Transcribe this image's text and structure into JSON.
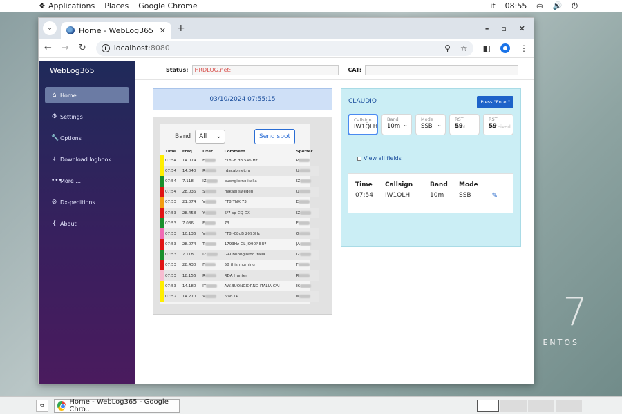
{
  "topbar": {
    "applications": "Applications",
    "places": "Places",
    "app_name": "Google Chrome",
    "lang": "it",
    "time": "08:55"
  },
  "desktop": {
    "logo_numeral": "7",
    "logo_text": "ENTOS"
  },
  "browser": {
    "tab_title": "Home - WebLog365",
    "url_host": "localhost",
    "url_port": ":8080"
  },
  "app": {
    "brand": "WebLog365",
    "nav": [
      {
        "label": "Home",
        "icon": "home-icon",
        "active": true
      },
      {
        "label": "Settings",
        "icon": "gear-icon",
        "active": false
      },
      {
        "label": "Options",
        "icon": "wrench-icon",
        "active": false
      },
      {
        "label": "Download logbook",
        "icon": "download-icon",
        "active": false
      },
      {
        "label": "More ...",
        "icon": "more-icon",
        "active": false
      },
      {
        "label": "Dx-peditions",
        "icon": "compass-icon",
        "active": false
      },
      {
        "label": "About",
        "icon": "braces-icon",
        "active": false
      }
    ],
    "status_label": "Status:",
    "status_value": "HRDLOG.net:",
    "cat_label": "CAT:",
    "datetime": "03/10/2024 07:55:15"
  },
  "spots": {
    "band_label": "Band",
    "band_value": "All",
    "send_spot": "Send spot",
    "columns": [
      "Time",
      "Freq",
      "Dxer",
      "Comment",
      "Spotter"
    ],
    "rows": [
      {
        "color": "#ffee00",
        "time": "07:54",
        "freq": "14.074",
        "dxer": "F",
        "comment": "FT8 -8 dB 546 Hz",
        "spotter": "P"
      },
      {
        "color": "#ffee00",
        "time": "07:54",
        "freq": "14.040",
        "dxer": "R",
        "comment": "rdacabinet.ru",
        "spotter": "U"
      },
      {
        "color": "#1a8f2c",
        "time": "07:54",
        "freq": "7.118",
        "dxer": "IZ",
        "comment": "buongiorno italia",
        "spotter": "IZ"
      },
      {
        "color": "#e01414",
        "time": "07:54",
        "freq": "28.036",
        "dxer": "S",
        "comment": "mikael sweden",
        "spotter": "U"
      },
      {
        "color": "#f39c12",
        "time": "07:53",
        "freq": "21.074",
        "dxer": "V",
        "comment": "FT8 TNX 73",
        "spotter": "E"
      },
      {
        "color": "#e01414",
        "time": "07:53",
        "freq": "28.458",
        "dxer": "Y",
        "comment": "5/7 sp CQ DX",
        "spotter": "IZ"
      },
      {
        "color": "#1a8f2c",
        "time": "07:53",
        "freq": "7.086",
        "dxer": "F",
        "comment": "73",
        "spotter": "F"
      },
      {
        "color": "#f06ab4",
        "time": "07:53",
        "freq": "10.136",
        "dxer": "V",
        "comment": "FT8 -08dB 2093Hz",
        "spotter": "G"
      },
      {
        "color": "#e01414",
        "time": "07:53",
        "freq": "28.074",
        "dxer": "T",
        "comment": "1793Hz GL JO90? EU?",
        "spotter": "JA"
      },
      {
        "color": "#1a8f2c",
        "time": "07:53",
        "freq": "7.118",
        "dxer": "IZ",
        "comment": "GAI Buongiorno italia",
        "spotter": "IZ"
      },
      {
        "color": "#e01414",
        "time": "07:53",
        "freq": "28.430",
        "dxer": "F",
        "comment": "58 this morning",
        "spotter": "F"
      },
      {
        "color": "#f7bcd0",
        "time": "07:53",
        "freq": "18.156",
        "dxer": "R",
        "comment": "RDA Hunter",
        "spotter": "R"
      },
      {
        "color": "#ffee00",
        "time": "07:53",
        "freq": "14.180",
        "dxer": "IT",
        "comment": "AW.BUONGIORNO ITALIA GAI",
        "spotter": "IK"
      },
      {
        "color": "#ffee00",
        "time": "07:52",
        "freq": "14.270",
        "dxer": "V",
        "comment": "Ivan LP",
        "spotter": "M"
      }
    ]
  },
  "qso": {
    "operator": "CLAUDIO",
    "enter_button": "Press \"Enter\"",
    "fields": [
      {
        "label": "Callsign",
        "value": "IW1QLH",
        "focus": true
      },
      {
        "label": "Band",
        "value": "10m",
        "select": true
      },
      {
        "label": "Mode",
        "value": "SSB",
        "select": true
      },
      {
        "label": "RST",
        "value": "59",
        "ghost": "Sent"
      },
      {
        "label": "RST",
        "value": "59",
        "ghost": "Received"
      }
    ],
    "view_all": "View all fields",
    "table_headers": [
      "Time",
      "Callsign",
      "Band",
      "Mode"
    ],
    "table_row": [
      "07:54",
      "IW1QLH",
      "10m",
      "SSB"
    ]
  },
  "taskbar": {
    "window_title": "Home - WebLog365 - Google Chro..."
  }
}
